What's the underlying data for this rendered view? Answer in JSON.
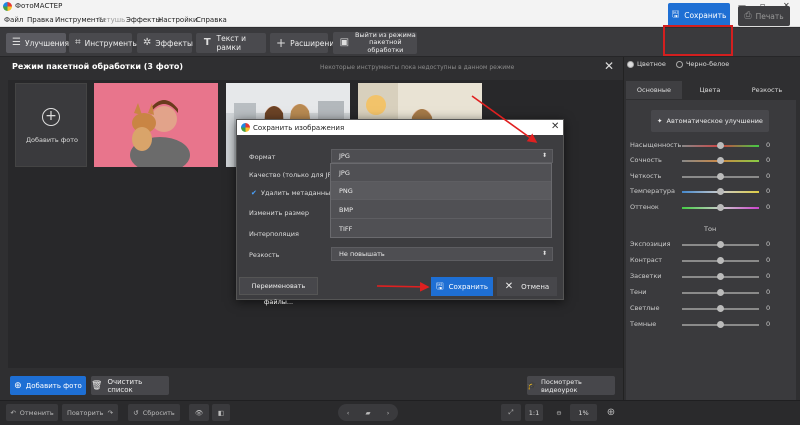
{
  "titlebar": {
    "title": "ФотоМАСТЕР",
    "minimize": "—",
    "maximize": "▫",
    "close": "✕"
  },
  "menu": [
    "Файл",
    "Правка",
    "Инструменты",
    "Ретушь",
    "Эффекты",
    "Настройки",
    "Справка"
  ],
  "toolbar": {
    "enhance": "Улучшения",
    "tools": "Инструменты",
    "effects": "Эффекты",
    "text_frames": "Текст и рамки",
    "extensions": "Расширения",
    "exit_batch_line1": "Выйти из режима",
    "exit_batch_line2": "пакетной обработки",
    "save": "Сохранить",
    "print": "Печать"
  },
  "main": {
    "title": "Режим пакетной обработки (3 фото)",
    "notice": "Некоторые инструменты пока недоступны в данном режиме",
    "add_photo_tile": "Добавить фото"
  },
  "dialog": {
    "title": "Сохранить изображения",
    "format_label": "Формат",
    "format_value": "JPG",
    "quality_label": "Качество (только для JPG)",
    "metadata_label": "Удалить метаданные (т",
    "resize_label": "Изменить размер",
    "interp_label": "Интерполяция",
    "sharpness_label": "Резкость",
    "sharpness_value": "Не повышать",
    "format_options": [
      "JPG",
      "PNG",
      "BMP",
      "TIFF"
    ],
    "rename_button": "Переименовать файлы...",
    "save_button": "Сохранить",
    "cancel_button": "Отмена"
  },
  "bottom": {
    "add_photo": "Добавить фото",
    "clear_list": "Очистить список",
    "watch_video": "Посмотреть видеоурок",
    "undo": "Отменить",
    "redo": "Повторить",
    "reset": "Сбросить",
    "ratio": "1:1",
    "zoom": "1%"
  },
  "right": {
    "mode_color": "Цветное",
    "mode_bw": "Черно-белое",
    "tabs": [
      "Основные",
      "Цвета",
      "Резкость"
    ],
    "auto_button": "Автоматическое улучшение",
    "sliders_top": [
      {
        "label": "Насыщенность",
        "value": "0"
      },
      {
        "label": "Сочность",
        "value": "0"
      },
      {
        "label": "Четкость",
        "value": "0"
      },
      {
        "label": "Температура",
        "value": "0"
      },
      {
        "label": "Оттенок",
        "value": "0"
      }
    ],
    "tone_header": "Тон",
    "sliders_tone": [
      {
        "label": "Экспозиция",
        "value": "0"
      },
      {
        "label": "Контраст",
        "value": "0"
      },
      {
        "label": "Засветки",
        "value": "0"
      },
      {
        "label": "Тени",
        "value": "0"
      },
      {
        "label": "Светлые",
        "value": "0"
      },
      {
        "label": "Темные",
        "value": "0"
      }
    ]
  },
  "colors": {
    "accent": "#1e6fd4",
    "highlight": "#d31f1f",
    "annotation_arrow": "#e02020"
  }
}
